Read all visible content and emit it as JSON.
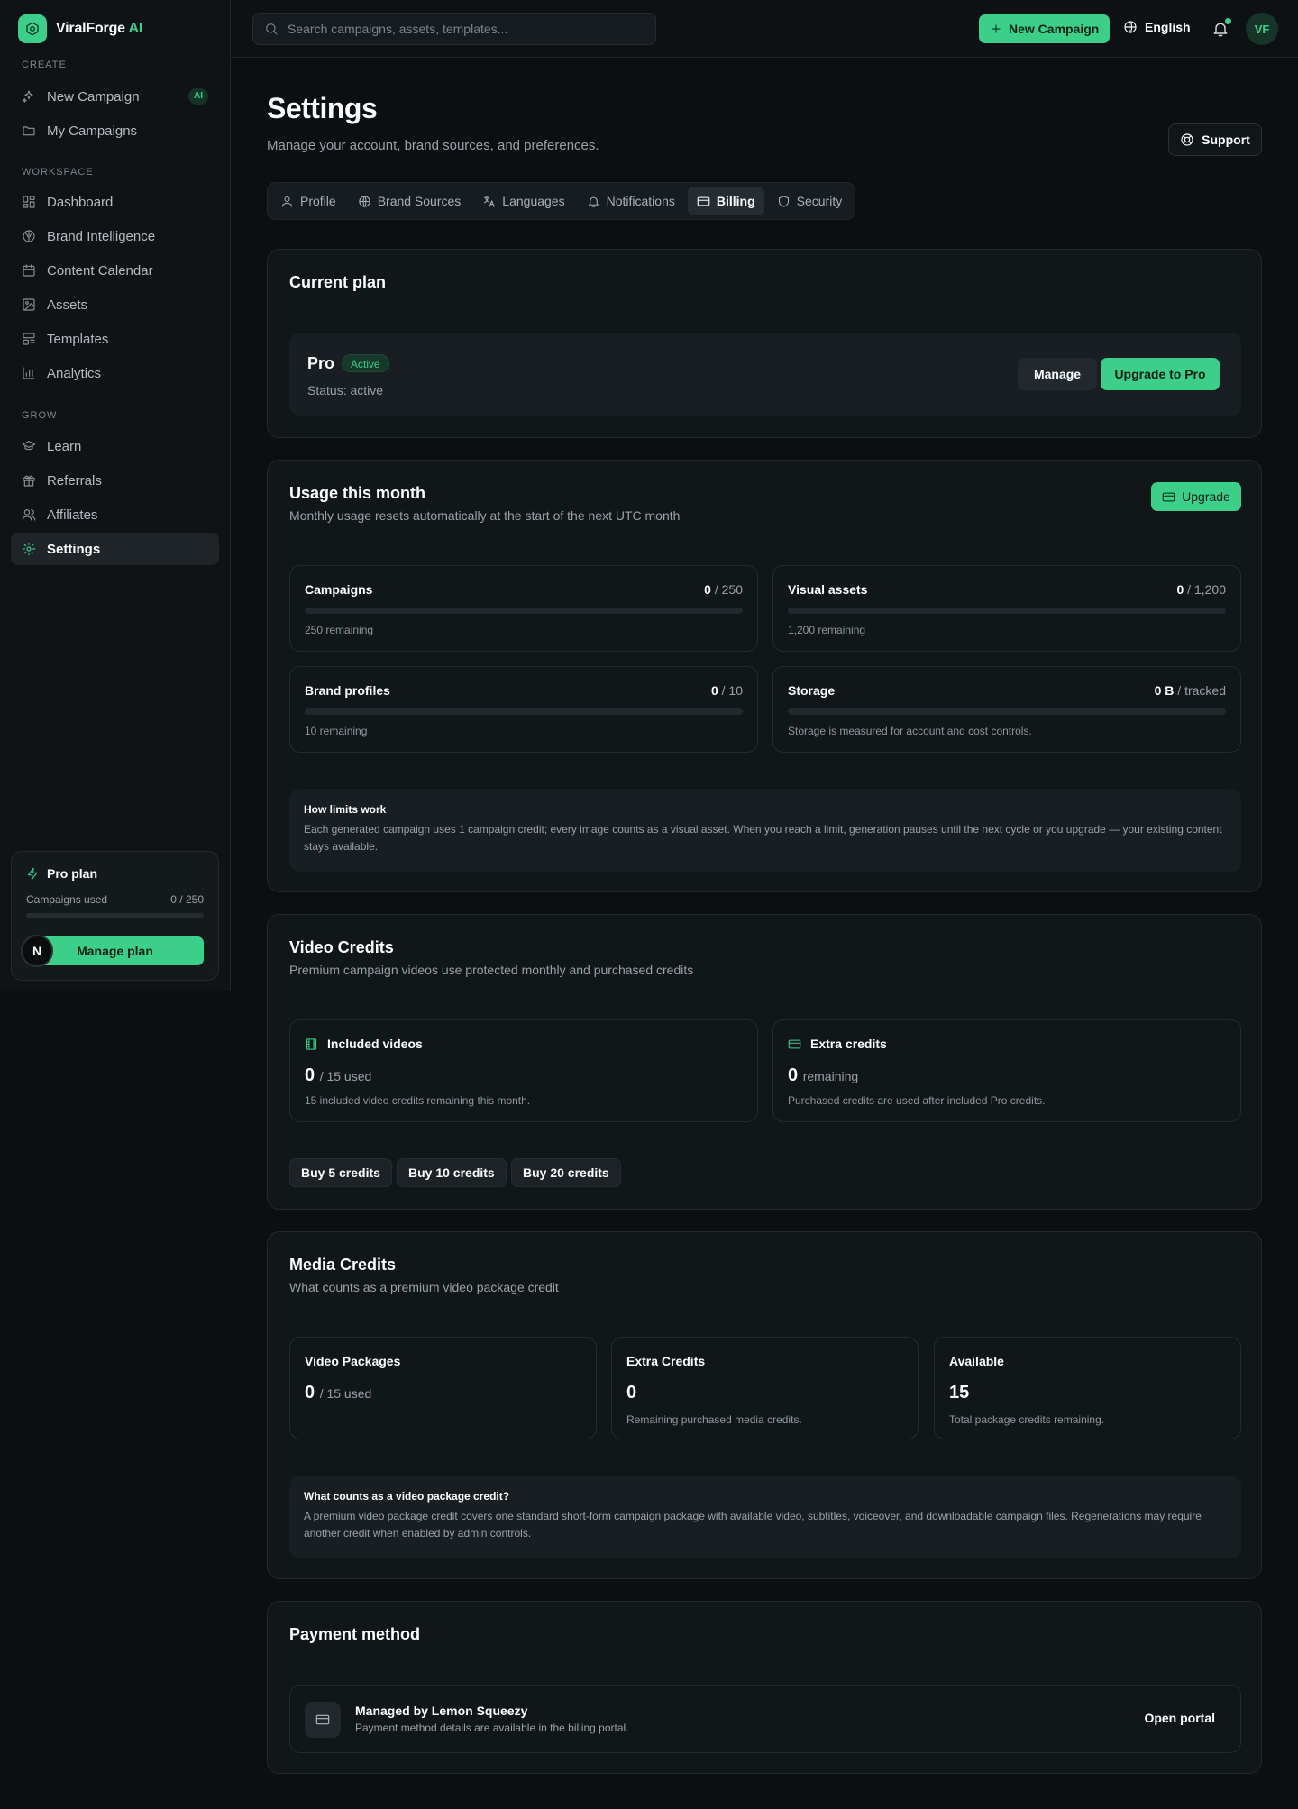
{
  "brand": {
    "name": "ViralForge",
    "suffix": "AI"
  },
  "sidebar": {
    "sections": {
      "create": "CREATE",
      "workspace": "WORKSPACE",
      "grow": "GROW"
    },
    "items": [
      {
        "label": "New Campaign",
        "icon": "sparkles-icon",
        "badge": "AI"
      },
      {
        "label": "My Campaigns",
        "icon": "folder-icon"
      },
      {
        "label": "Dashboard",
        "icon": "grid-icon"
      },
      {
        "label": "Brand Intelligence",
        "icon": "brain-icon"
      },
      {
        "label": "Content Calendar",
        "icon": "calendar-icon"
      },
      {
        "label": "Assets",
        "icon": "image-icon"
      },
      {
        "label": "Templates",
        "icon": "template-icon"
      },
      {
        "label": "Analytics",
        "icon": "chart-icon"
      },
      {
        "label": "Learn",
        "icon": "graduation-cap-icon"
      },
      {
        "label": "Referrals",
        "icon": "gift-icon"
      },
      {
        "label": "Affiliates",
        "icon": "users-icon"
      },
      {
        "label": "Settings",
        "icon": "gear-icon",
        "active": true
      }
    ],
    "plan": {
      "title": "Pro plan",
      "usage_label": "Campaigns used",
      "usage_value": "0 / 250",
      "usage_fraction": 0,
      "button": "Manage plan",
      "badge_letter": "N"
    }
  },
  "topbar": {
    "search_placeholder": "Search campaigns, assets, templates...",
    "new_campaign": "New Campaign",
    "language": "English",
    "avatar": "VF"
  },
  "page": {
    "title": "Settings",
    "subtitle": "Manage your account, brand sources, and preferences.",
    "support": "Support",
    "tabs": [
      {
        "label": "Profile",
        "icon": "user-icon"
      },
      {
        "label": "Brand Sources",
        "icon": "globe-icon"
      },
      {
        "label": "Languages",
        "icon": "translate-icon"
      },
      {
        "label": "Notifications",
        "icon": "bell-icon"
      },
      {
        "label": "Billing",
        "icon": "credit-card-icon",
        "active": true
      },
      {
        "label": "Security",
        "icon": "shield-icon"
      }
    ]
  },
  "current_plan": {
    "title": "Current plan",
    "plan_name": "Pro",
    "badge": "Active",
    "status": "Status: active",
    "manage": "Manage",
    "upgrade": "Upgrade to Pro"
  },
  "usage": {
    "title": "Usage this month",
    "subtitle": "Monthly usage resets automatically at the start of the next UTC month",
    "upgrade": "Upgrade",
    "items": [
      {
        "name": "Campaigns",
        "used": "0",
        "limit": "/ 250",
        "note": "250 remaining",
        "fraction": 0
      },
      {
        "name": "Visual assets",
        "used": "0",
        "limit": "/ 1,200",
        "note": "1,200 remaining",
        "fraction": 0
      },
      {
        "name": "Brand profiles",
        "used": "0",
        "limit": "/ 10",
        "note": "10 remaining",
        "fraction": 0
      },
      {
        "name": "Storage",
        "used": "0 B",
        "limit": "/ tracked",
        "note": "Storage is measured for account and cost controls.",
        "fraction": 0
      }
    ],
    "info_title": "How limits work",
    "info_text": "Each generated campaign uses 1 campaign credit; every image counts as a visual asset. When you reach a limit, generation pauses until the next cycle or you upgrade — your existing content stays available."
  },
  "video_credits": {
    "title": "Video Credits",
    "subtitle": "Premium campaign videos use protected monthly and purchased credits",
    "included": {
      "title": "Included videos",
      "value": "0",
      "suffix": "/ 15 used",
      "note": "15 included video credits remaining this month."
    },
    "extra": {
      "title": "Extra credits",
      "value": "0",
      "suffix": "remaining",
      "note": "Purchased credits are used after included Pro credits."
    },
    "buy": [
      "Buy 5 credits",
      "Buy 10 credits",
      "Buy 20 credits"
    ]
  },
  "media_credits": {
    "title": "Media Credits",
    "subtitle": "What counts as a premium video package credit",
    "boxes": [
      {
        "title": "Video Packages",
        "value": "0",
        "suffix": "/ 15 used",
        "note": ""
      },
      {
        "title": "Extra Credits",
        "value": "0",
        "suffix": "",
        "note": "Remaining purchased media credits."
      },
      {
        "title": "Available",
        "value": "15",
        "suffix": "",
        "note": "Total package credits remaining."
      }
    ],
    "info_title": "What counts as a video package credit?",
    "info_text": "A premium video package credit covers one standard short-form campaign package with available video, subtitles, voiceover, and downloadable campaign files. Regenerations may require another credit when enabled by admin controls."
  },
  "payment": {
    "title": "Payment method",
    "provider": "Managed by Lemon Squeezy",
    "note": "Payment method details are available in the billing portal.",
    "open": "Open portal"
  },
  "colors": {
    "accent": "#3ccf8a",
    "background": "#0b0f12",
    "card": "#111619"
  }
}
